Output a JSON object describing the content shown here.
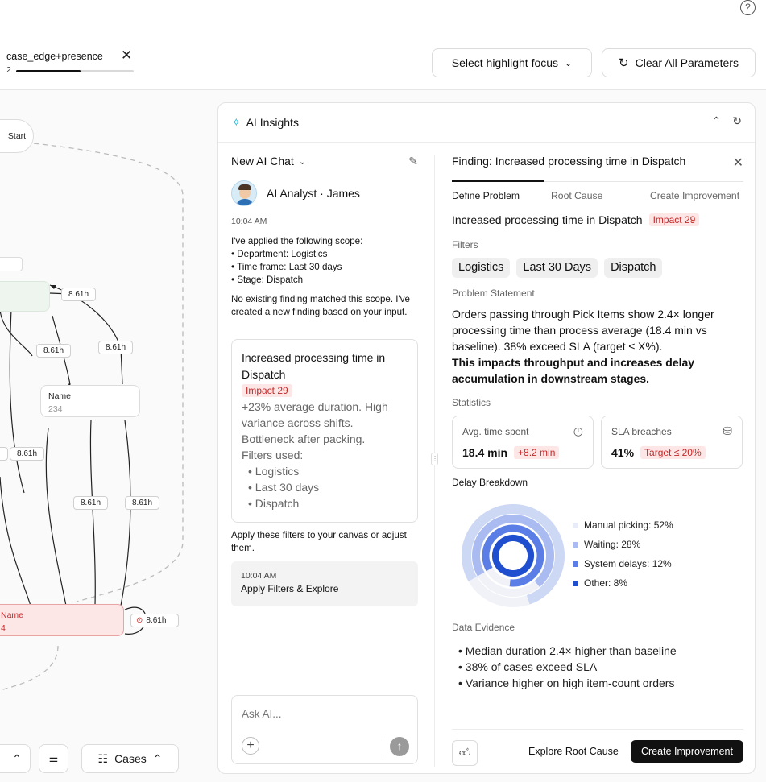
{
  "topbar": {
    "help_icon": "?"
  },
  "parameters": {
    "chip_name": "case_edge+presence",
    "chip_count": "2",
    "chip_progress": 0.55,
    "highlight_label": "Select highlight focus",
    "clear_label": "Clear All Parameters"
  },
  "canvas": {
    "start_label": "Start",
    "node_name": "Name",
    "node_value": "234",
    "bottom_node_name": "Name",
    "bottom_node_value": "4",
    "edge_labels": [
      "8.61h",
      "8.61h",
      "8.61h",
      "8.61h",
      "8.61h",
      "8.61h",
      "8.61h"
    ],
    "loop_label": "8.61h",
    "cases_label": "Cases"
  },
  "panel": {
    "title": "AI Insights",
    "chat": {
      "header": "New AI Chat",
      "analyst_name": "AI Analyst · James",
      "time": "10:04 AM",
      "scope_intro": "I've applied the following scope:",
      "scope_items": [
        "• Department: Logistics",
        "• Time frame: Last 30 days",
        "• Stage: Dispatch"
      ],
      "no_finding": "No existing finding matched this scope. I've created a new finding based on your input.",
      "card": {
        "title": "Increased processing time in Dispatch",
        "impact": "Impact 29",
        "body": "+23% average duration. High variance across shifts. Bottleneck after packing.",
        "filters_used": "Filters used:",
        "filters": [
          "Logistics",
          "Last 30 days",
          "Dispatch"
        ]
      },
      "apply_prompt": "Apply these filters to your canvas or adjust them.",
      "explore_time": "10:04 AM",
      "explore_action": "Apply Filters & Explore",
      "ask_placeholder": "Ask AI..."
    },
    "finding": {
      "title": "Finding: Increased processing time in Dispatch",
      "tabs": [
        "Define Problem",
        "Root Cause",
        "Create Improvement"
      ],
      "heading": "Increased processing time in Dispatch",
      "impact": "Impact 29",
      "filters_label": "Filters",
      "filters": [
        "Logistics",
        "Last 30 Days",
        "Dispatch"
      ],
      "problem_label": "Problem Statement",
      "problem_text": "Orders passing through Pick Items show 2.4× longer processing time than process average (18.4 min vs baseline). 38% exceed SLA (target ≤ X%).",
      "problem_bold": "This impacts throughput and increases delay accumulation in downstream stages.",
      "stats_label": "Statistics",
      "stat1": {
        "label": "Avg. time spent",
        "value": "18.4 min",
        "delta": "+8.2 min",
        "icon": "clock-icon"
      },
      "stat2": {
        "label": "SLA breaches",
        "value": "41%",
        "delta": "Target ≤ 20%",
        "icon": "database-icon"
      },
      "delay_label": "Delay Breakdown",
      "breakdown": [
        {
          "label": "Manual picking: 52%",
          "value": 52,
          "color": "#e7ecf8"
        },
        {
          "label": "Waiting: 28%",
          "value": 28,
          "color": "#a9bbf0"
        },
        {
          "label": "System delays: 12%",
          "value": 12,
          "color": "#5a7de6"
        },
        {
          "label": "Other: 8%",
          "value": 8,
          "color": "#1f4fcf"
        }
      ],
      "evidence_label": "Data Evidence",
      "evidence": [
        "Median duration 2.4× higher than baseline",
        "38% of cases exceed SLA",
        "Variance higher on high item-count orders"
      ],
      "explore_root": "Explore Root Cause",
      "create_improvement": "Create Improvement"
    }
  }
}
